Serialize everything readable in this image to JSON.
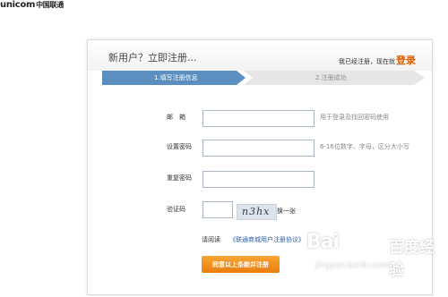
{
  "brand": {
    "name_latin": "unicom",
    "name_cn": "中国联通"
  },
  "header": {
    "title": "新用户？立即注册...",
    "login_hint": "我已经注册，现在就",
    "login_link": "登录"
  },
  "steps": [
    {
      "label": "1.填写注册信息",
      "active": true
    },
    {
      "label": "2.注册成功",
      "active": false
    }
  ],
  "form": {
    "email": {
      "label": "邮　箱",
      "value": "",
      "hint": "用于登录及找回密码使用"
    },
    "password": {
      "label": "设置密码",
      "value": "",
      "hint": "6-16位数字、字母，区分大小写"
    },
    "confirm_password": {
      "label": "重复密码",
      "value": ""
    },
    "captcha": {
      "label": "验证码",
      "value": "",
      "image_text": "n3hx",
      "refresh_label": "换一张"
    },
    "agreement": {
      "prefix": "请阅读",
      "link": "《联通商城用户注册协议》"
    },
    "submit_label": "同意以上条款并注册"
  },
  "watermark": {
    "brand": "Bai",
    "brand_cn": "百度",
    "label": "经验",
    "url": "jingyan.baidu.com"
  },
  "colors": {
    "accent": "#ea7d0f",
    "step_active": "#5a8fc0",
    "step_inactive": "#e6e6e6",
    "link": "#2a5ea8"
  }
}
